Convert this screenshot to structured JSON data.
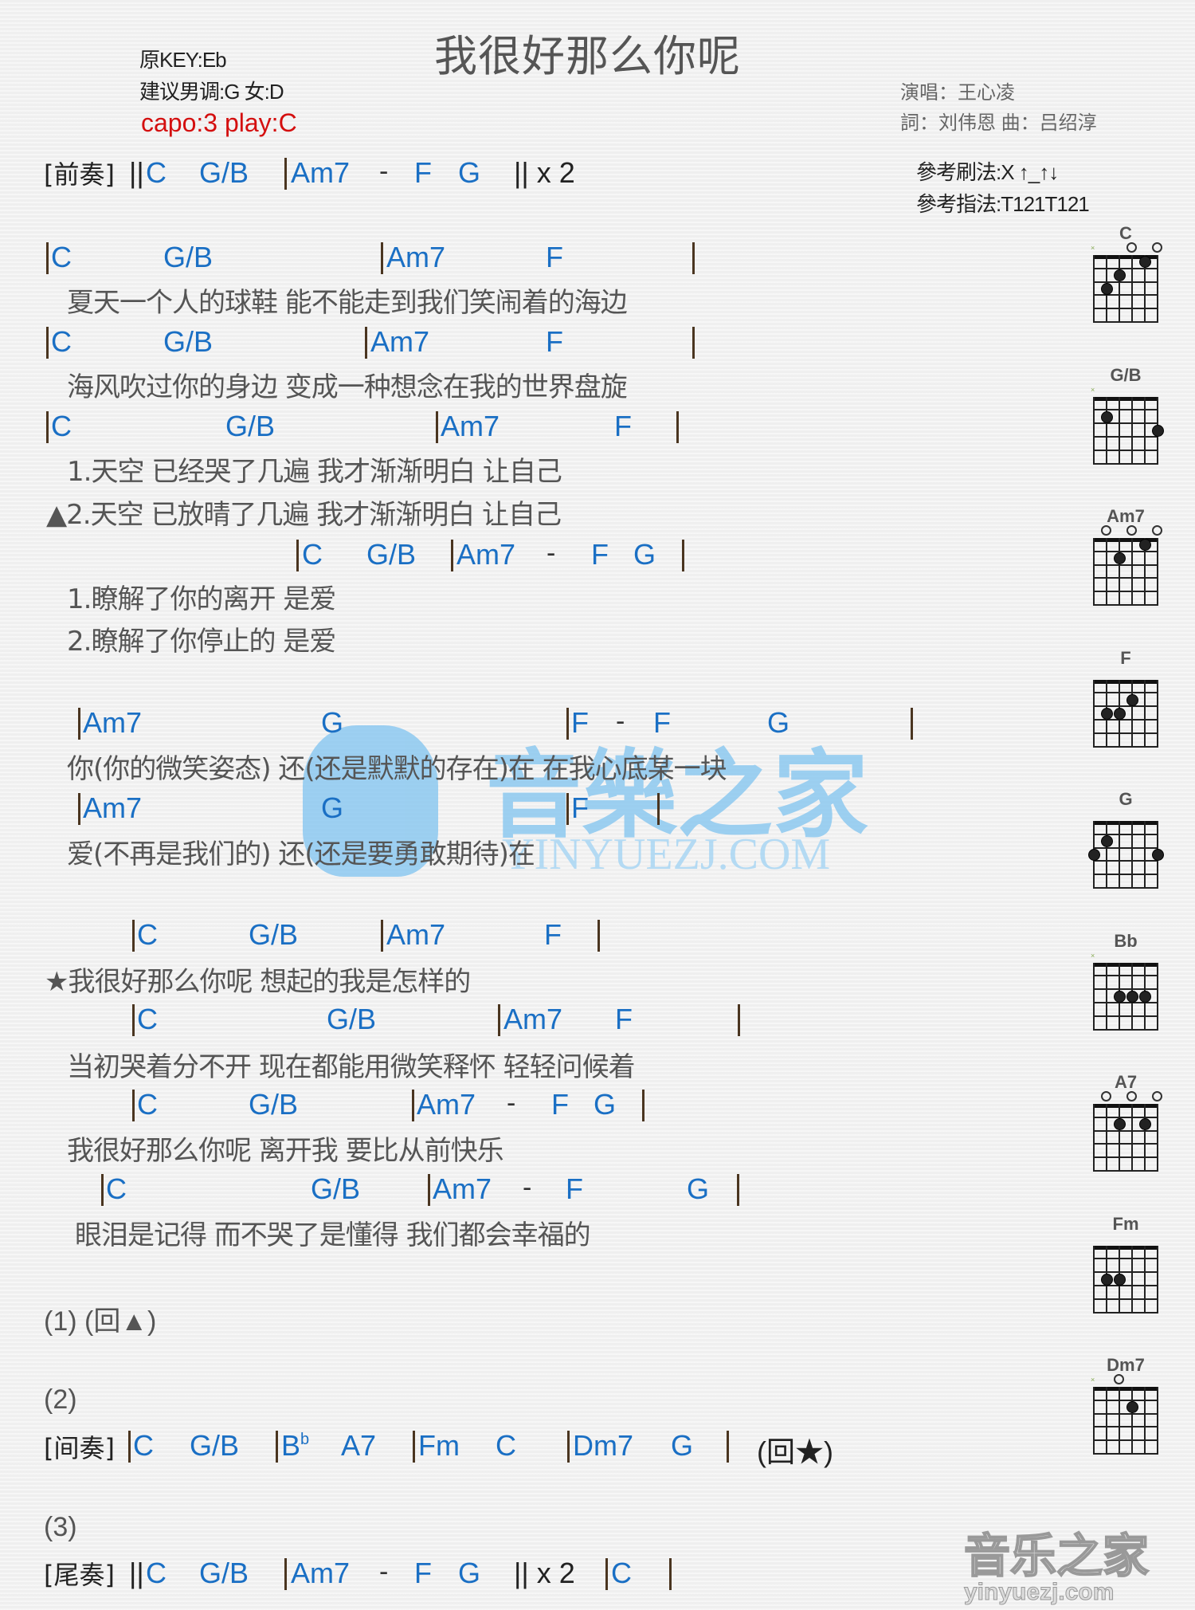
{
  "title": "我很好那么你呢",
  "key_info": {
    "original_key": "原KEY:Eb",
    "suggested": "建议男调:G 女:D",
    "capo": "capo:3 play:C"
  },
  "credits": {
    "singer": "演唱：王心凌",
    "writers": "詞：刘伟恩    曲：吕绍淳"
  },
  "reference": {
    "strum": "參考刷法:X ↑_↑↓",
    "picking": "參考指法:T121T121"
  },
  "colors": {
    "chord": "#1a6fc4",
    "capo": "#d40f0f",
    "lyric": "#555555",
    "bar": "#4a3520"
  },
  "sections": {
    "prelude": {
      "tag": "[前奏]",
      "start": "||",
      "chords": [
        "C",
        "G/B",
        "Am7",
        "-",
        "F",
        "G"
      ],
      "end": "|| x 2"
    },
    "interlude": {
      "label": "(2)",
      "tag": "[间奏]",
      "chords": [
        "C",
        "G/B",
        "B",
        "b",
        "A7",
        "Fm",
        "C",
        "Dm7",
        "G"
      ],
      "end": "(回★)"
    },
    "outro": {
      "label": "(3)",
      "tag": "[尾奏]",
      "start": "||",
      "chords": [
        "C",
        "G/B",
        "Am7",
        "-",
        "F",
        "G",
        "C"
      ],
      "repeat": "|| x 2"
    },
    "return1": "(1)  (回▲)"
  },
  "verse": {
    "rows": [
      {
        "chords": [
          "C",
          "G/B",
          "Am7",
          "F"
        ],
        "lyric": "夏天一个人的球鞋    能不能走到我们笑闹着的海边"
      },
      {
        "chords": [
          "C",
          "G/B",
          "Am7",
          "F"
        ],
        "lyric": "海风吹过你的身边    变成一种想念在我的世界盘旋"
      },
      {
        "chords": [
          "C",
          "G/B",
          "Am7",
          "F"
        ],
        "lyric": "1.天空    已经哭了几遍    我才渐渐明白      让自己",
        "lyric2": "▲2.天空    已放晴了几遍    我才渐渐明白      让自己"
      },
      {
        "chords": [
          "C",
          "G/B",
          "Am7",
          "-",
          "F",
          "G"
        ],
        "lyric": "1.瞭解了你的离开    是爱",
        "lyric2": "2.瞭解了你停止的    是爱"
      }
    ]
  },
  "prechorus": {
    "rows": [
      {
        "chords": [
          "Am7",
          "G",
          "F",
          "-",
          "F",
          "G"
        ],
        "lyric": "你(你的微笑姿态)    还(还是默默的存在)在          在我心底某一块"
      },
      {
        "chords": [
          "Am7",
          "G",
          "F"
        ],
        "lyric": "爱(不再是我们的)    还(还是要勇敢期待)在"
      }
    ]
  },
  "chorus": {
    "rows": [
      {
        "chords": [
          "C",
          "G/B",
          "Am7",
          "F"
        ],
        "lyric": "★我很好那么你呢    想起的我是怎样的"
      },
      {
        "chords": [
          "C",
          "G/B",
          "Am7",
          "F"
        ],
        "lyric": "当初哭着分不开    现在都能用微笑释怀        轻轻问候着"
      },
      {
        "chords": [
          "C",
          "G/B",
          "Am7",
          "-",
          "F",
          "G"
        ],
        "lyric": "我很好那么你呢    离开我    要比从前快乐"
      },
      {
        "chords": [
          "C",
          "G/B",
          "Am7",
          "-",
          "F",
          "G"
        ],
        "lyric": "眼泪是记得    而不哭了是懂得          我们都会幸福的"
      }
    ]
  },
  "chord_diagrams": [
    {
      "name": "C",
      "muted": [
        6
      ],
      "open": [
        3,
        1
      ],
      "dots": [
        [
          2,
          1
        ],
        [
          4,
          2
        ],
        [
          5,
          3
        ]
      ]
    },
    {
      "name": "G/B",
      "muted": [
        6
      ],
      "open": [],
      "dots": [
        [
          5,
          2
        ],
        [
          1,
          3
        ]
      ]
    },
    {
      "name": "Am7",
      "muted": [],
      "open": [
        5,
        3,
        1
      ],
      "dots": [
        [
          2,
          1
        ],
        [
          4,
          2
        ]
      ]
    },
    {
      "name": "F",
      "muted": [],
      "open": [],
      "barre": [
        1,
        6,
        1
      ],
      "dots": [
        [
          3,
          2
        ],
        [
          5,
          3
        ],
        [
          4,
          3
        ]
      ]
    },
    {
      "name": "G",
      "muted": [],
      "open": [],
      "dots": [
        [
          5,
          2
        ],
        [
          6,
          3
        ],
        [
          1,
          3
        ]
      ]
    },
    {
      "name": "Bb",
      "muted": [
        6
      ],
      "open": [],
      "barre": [
        1,
        5,
        1
      ],
      "dots": [
        [
          4,
          3
        ],
        [
          3,
          3
        ],
        [
          2,
          3
        ]
      ]
    },
    {
      "name": "A7",
      "muted": [],
      "open": [
        5,
        3,
        1
      ],
      "dots": [
        [
          4,
          2
        ],
        [
          2,
          2
        ]
      ]
    },
    {
      "name": "Fm",
      "muted": [],
      "open": [],
      "barre": [
        1,
        6,
        1
      ],
      "dots": [
        [
          5,
          3
        ],
        [
          4,
          3
        ]
      ]
    },
    {
      "name": "Dm7",
      "muted": [
        6
      ],
      "open": [
        4
      ],
      "barre": [
        1,
        2,
        1
      ],
      "dots": [
        [
          3,
          2
        ]
      ]
    }
  ],
  "watermark": {
    "text": "音樂之家",
    "url": "YINYUEZJ.COM",
    "corner_text": "音乐之家",
    "corner_url": "yinyuezj.com"
  }
}
